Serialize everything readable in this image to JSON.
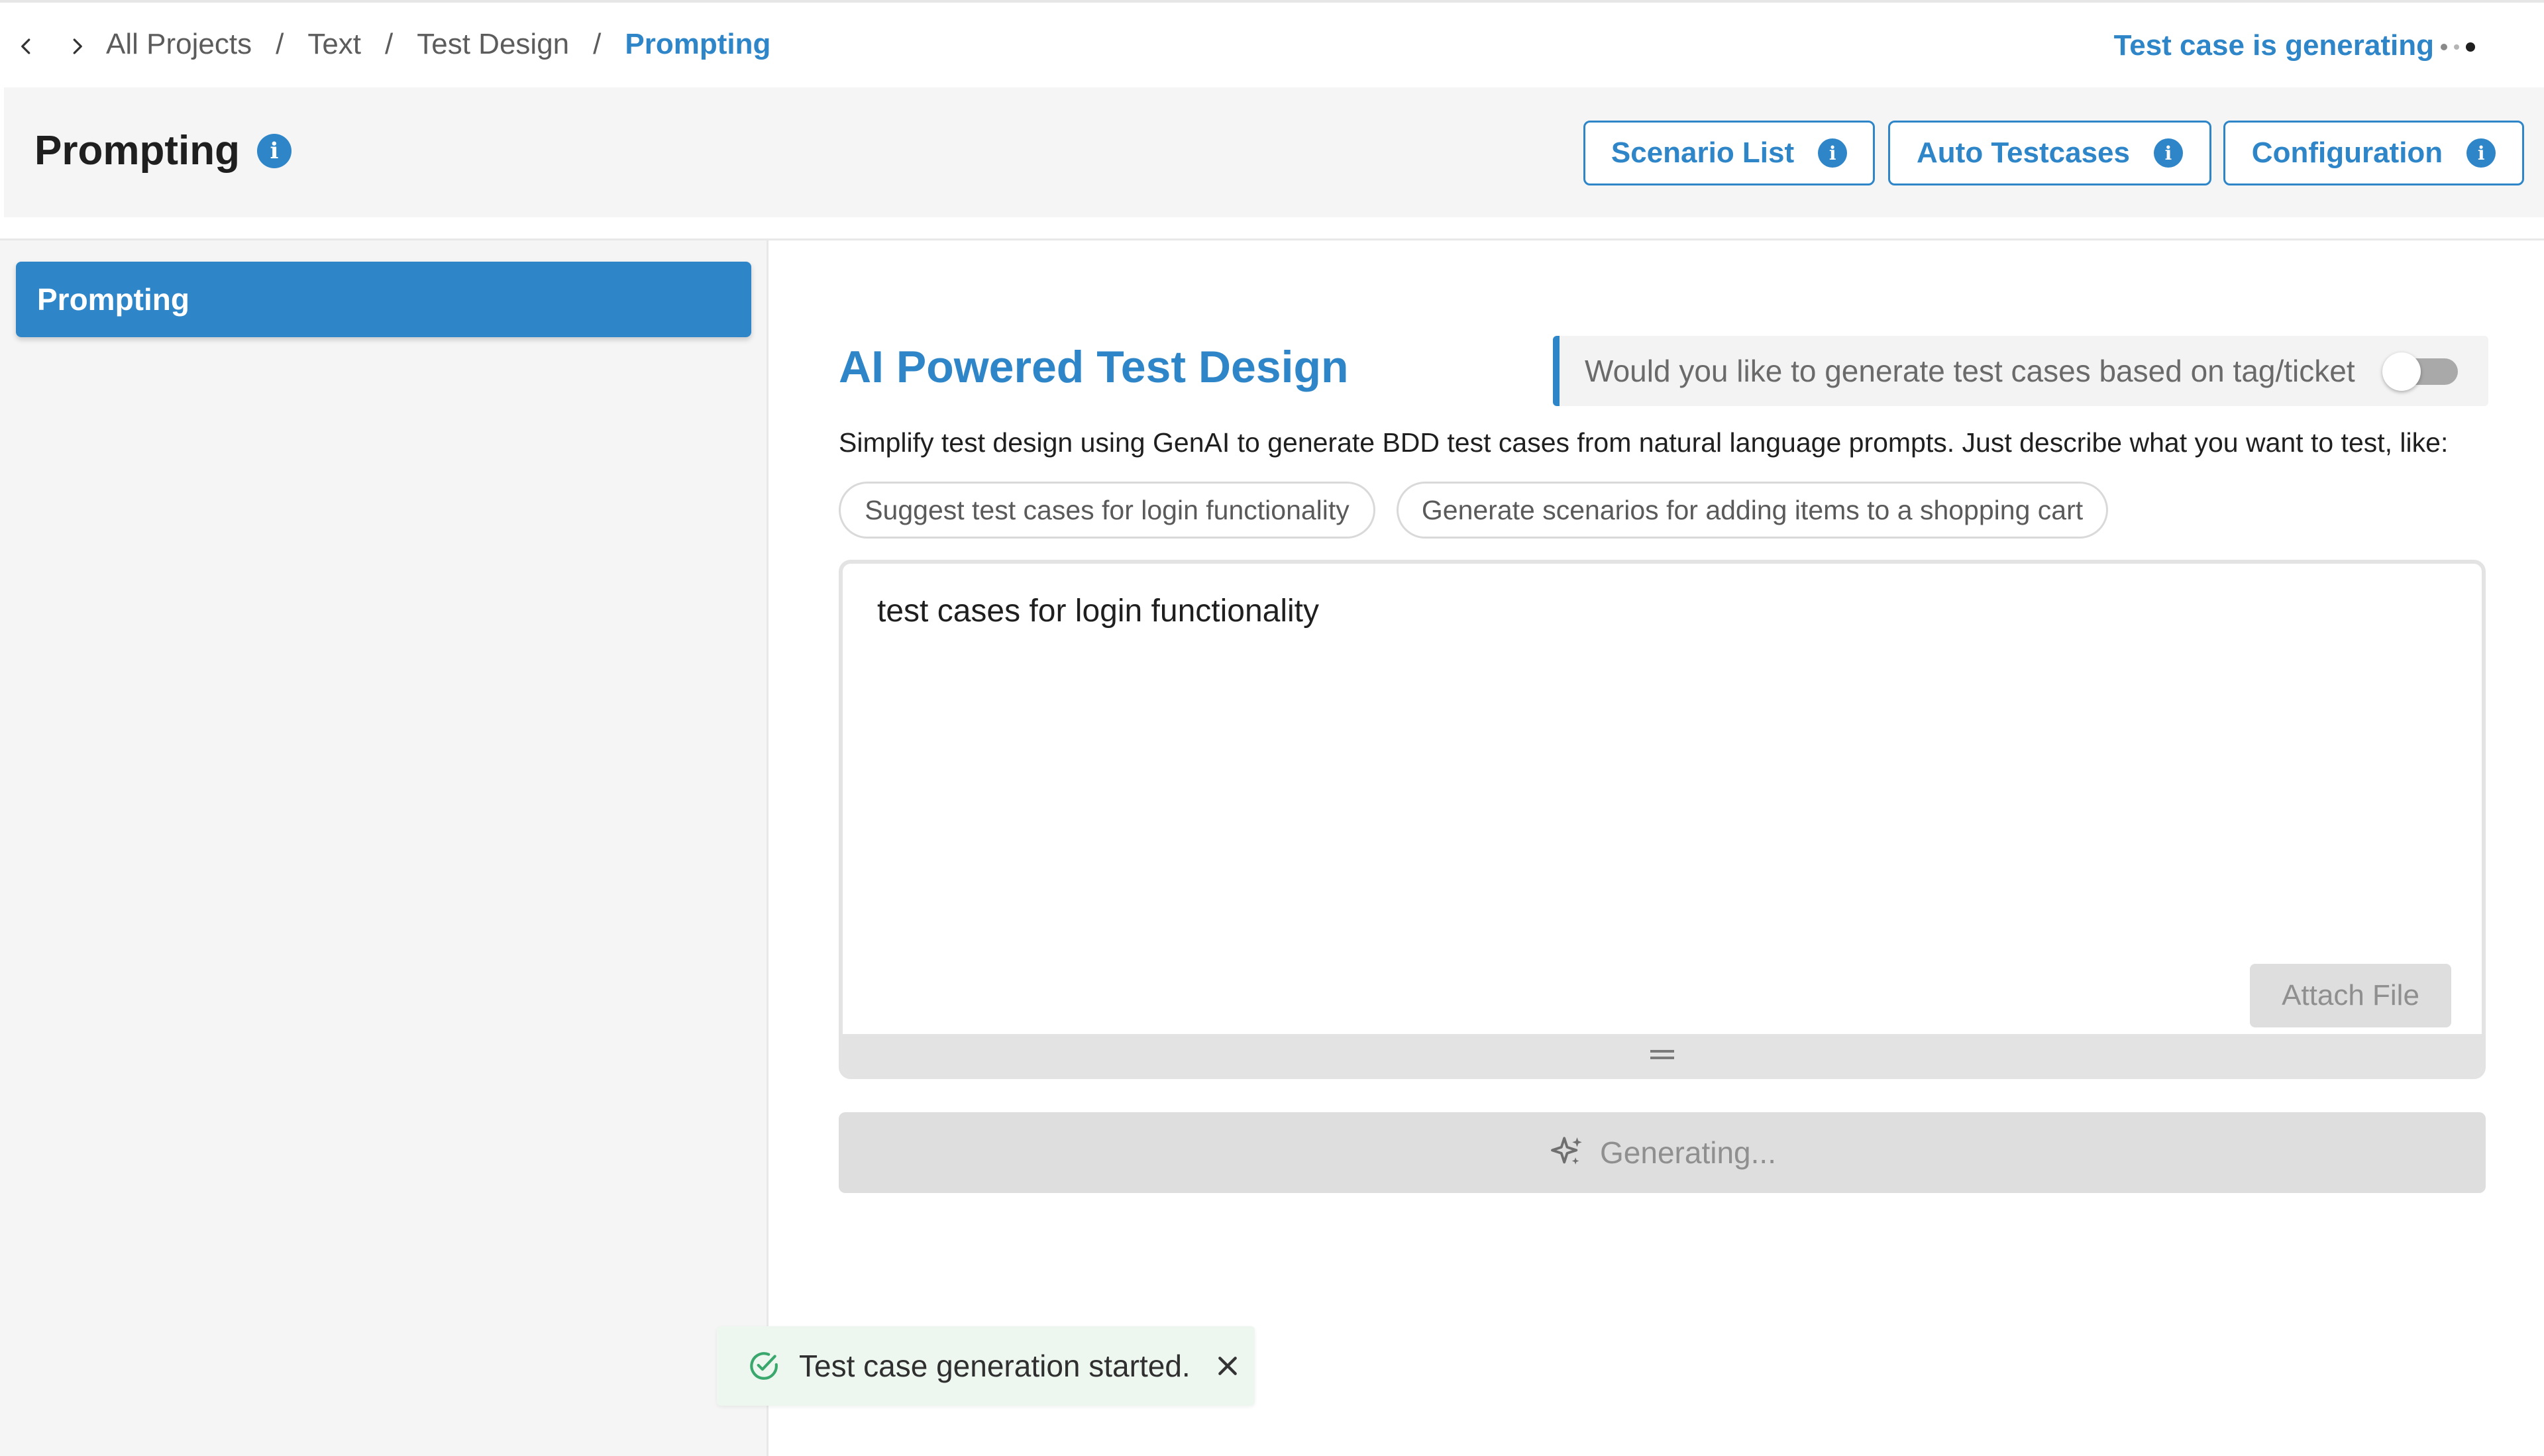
{
  "breadcrumb": {
    "items": [
      "All Projects",
      "Text",
      "Test Design"
    ],
    "current": "Prompting",
    "separator": "/"
  },
  "status": {
    "generating": "Test case is generating"
  },
  "header": {
    "title": "Prompting",
    "buttons": {
      "scenario_list": "Scenario List",
      "auto_testcases": "Auto Testcases",
      "configuration": "Configuration"
    }
  },
  "sidebar": {
    "items": [
      {
        "label": "Prompting",
        "active": true
      }
    ]
  },
  "main": {
    "title": "AI Powered Test Design",
    "tag_toggle_label": "Would you like to generate test cases based on tag/ticket",
    "tag_toggle_on": false,
    "description": "Simplify test design using GenAI to generate BDD test cases from natural language prompts. Just describe what you want to test, like:",
    "suggestions": [
      "Suggest test cases for login functionality",
      "Generate scenarios for adding items to a shopping cart"
    ],
    "prompt_value": "test cases for login functionality",
    "attach_label": "Attach File",
    "generate_label": "Generating..."
  },
  "toast": {
    "message": "Test case generation started."
  },
  "colors": {
    "accent": "#2e86c8",
    "success": "#3aa76d",
    "disabled_bg": "#dedede"
  }
}
